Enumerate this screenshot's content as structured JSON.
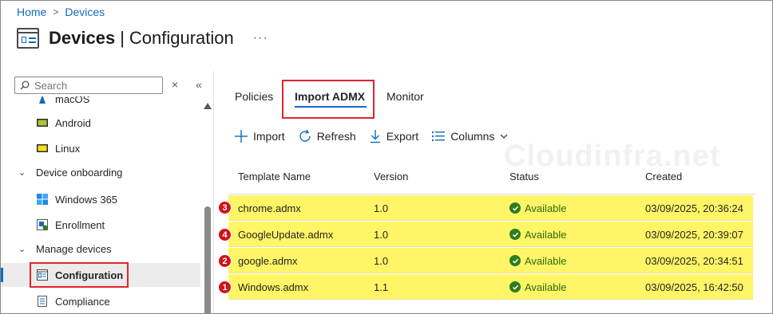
{
  "breadcrumb": {
    "home": "Home",
    "separator": ">",
    "current": "Devices"
  },
  "header": {
    "title_main": "Devices",
    "title_sub": "Configuration",
    "more": "···",
    "icon": "configuration-icon"
  },
  "search": {
    "placeholder": "Search",
    "value": ""
  },
  "sidebar_controls": {
    "clear": "×",
    "collapse": "«"
  },
  "nav": {
    "cut_item": "macOS",
    "android": "Android",
    "linux": "Linux",
    "device_onboarding": "Device onboarding",
    "windows365": "Windows 365",
    "enrollment": "Enrollment",
    "manage_devices": "Manage devices",
    "configuration": "Configuration",
    "compliance": "Compliance"
  },
  "tabs": {
    "policies": "Policies",
    "import_admx": "Import ADMX",
    "monitor": "Monitor"
  },
  "toolbar": {
    "import": "Import",
    "refresh": "Refresh",
    "export": "Export",
    "columns": "Columns"
  },
  "watermark": "Cloudinfra.net",
  "table": {
    "headers": {
      "name": "Template Name",
      "version": "Version",
      "status": "Status",
      "created": "Created"
    },
    "rows": [
      {
        "badge": "3",
        "name": "chrome.admx",
        "version": "1.0",
        "status": "Available",
        "created": "03/09/2025, 20:36:24"
      },
      {
        "badge": "4",
        "name": "GoogleUpdate.admx",
        "version": "1.0",
        "status": "Available",
        "created": "03/09/2025, 20:39:07"
      },
      {
        "badge": "2",
        "name": "google.admx",
        "version": "1.0",
        "status": "Available",
        "created": "03/09/2025, 20:34:51"
      },
      {
        "badge": "1",
        "name": "Windows.admx",
        "version": "1.1",
        "status": "Available",
        "created": "03/09/2025, 16:42:50"
      }
    ]
  },
  "colors": {
    "accent": "#0f6cbd",
    "highlight": "#fff566",
    "annotation": "#e0242f",
    "status_ok": "#2e7d1e"
  }
}
